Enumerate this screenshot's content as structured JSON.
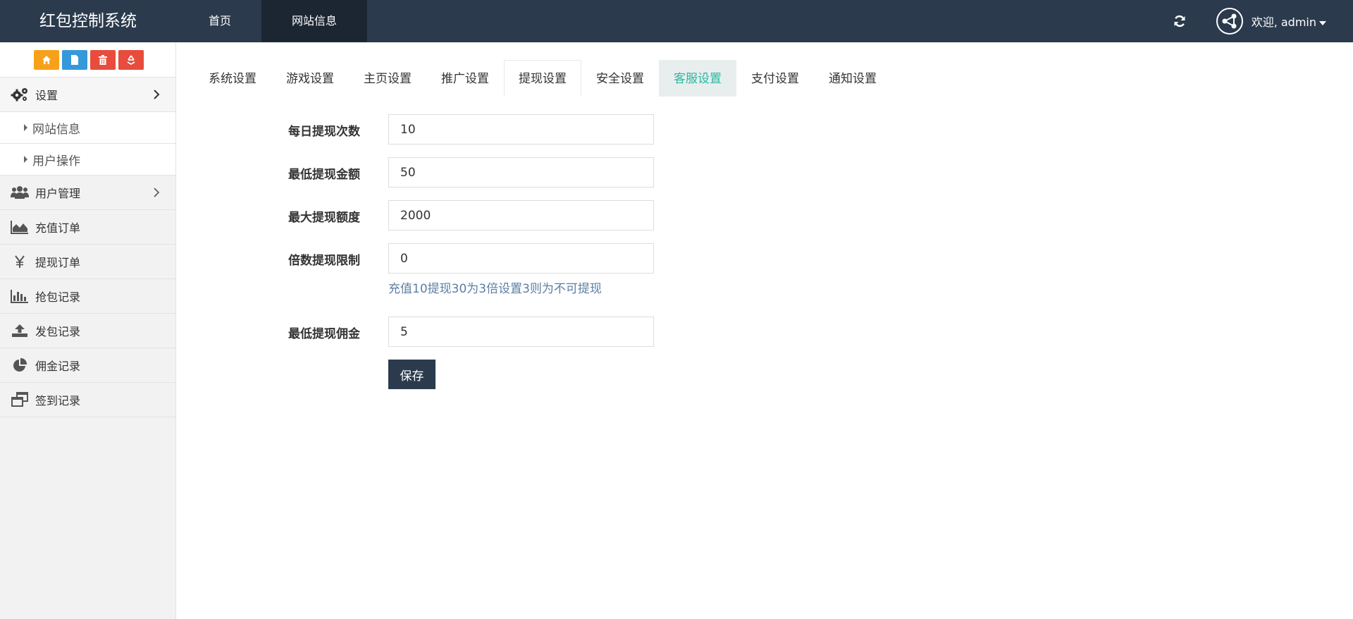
{
  "header": {
    "brand": "红包控制系统",
    "nav": [
      {
        "label": "首页"
      },
      {
        "label": "网站信息"
      }
    ],
    "welcome": "欢迎, admin"
  },
  "sidebar": {
    "shortcuts": [
      {
        "icon": "home-icon",
        "color": "#f7a11a"
      },
      {
        "icon": "file-icon",
        "color": "#3599d9"
      },
      {
        "icon": "trash-icon",
        "color": "#e74c3c"
      },
      {
        "icon": "recycle-icon",
        "color": "#e74c3c"
      }
    ],
    "menu": [
      {
        "label": "设置",
        "icon": "gears-icon"
      },
      {
        "label": "网站信息"
      },
      {
        "label": "用户操作"
      },
      {
        "label": "用户管理",
        "icon": "users-icon"
      },
      {
        "label": "充值订单",
        "icon": "area-chart-icon"
      },
      {
        "label": "提现订单",
        "icon": "yen-icon"
      },
      {
        "label": "抢包记录",
        "icon": "bar-chart-icon"
      },
      {
        "label": "发包记录",
        "icon": "upload-icon"
      },
      {
        "label": "佣金记录",
        "icon": "pie-chart-icon"
      },
      {
        "label": "签到记录",
        "icon": "windows-icon"
      }
    ]
  },
  "tabs": [
    {
      "label": "系统设置"
    },
    {
      "label": "游戏设置"
    },
    {
      "label": "主页设置"
    },
    {
      "label": "推广设置"
    },
    {
      "label": "提现设置"
    },
    {
      "label": "安全设置"
    },
    {
      "label": "客服设置"
    },
    {
      "label": "支付设置"
    },
    {
      "label": "通知设置"
    }
  ],
  "form": {
    "daily_count": {
      "label": "每日提现次数",
      "value": "10"
    },
    "min_amount": {
      "label": "最低提现金额",
      "value": "50"
    },
    "max_amount": {
      "label": "最大提现额度",
      "value": "2000"
    },
    "multiple_limit": {
      "label": "倍数提现限制",
      "value": "0",
      "hint": "充值10提现30为3倍设置3则为不可提现"
    },
    "min_commission": {
      "label": "最低提现佣金",
      "value": "5"
    },
    "save_label": "保存"
  },
  "colors": {
    "header_bg": "#2b3a4d",
    "accent_teal": "#2ab7a0",
    "hint_blue": "#5b7fa3"
  }
}
